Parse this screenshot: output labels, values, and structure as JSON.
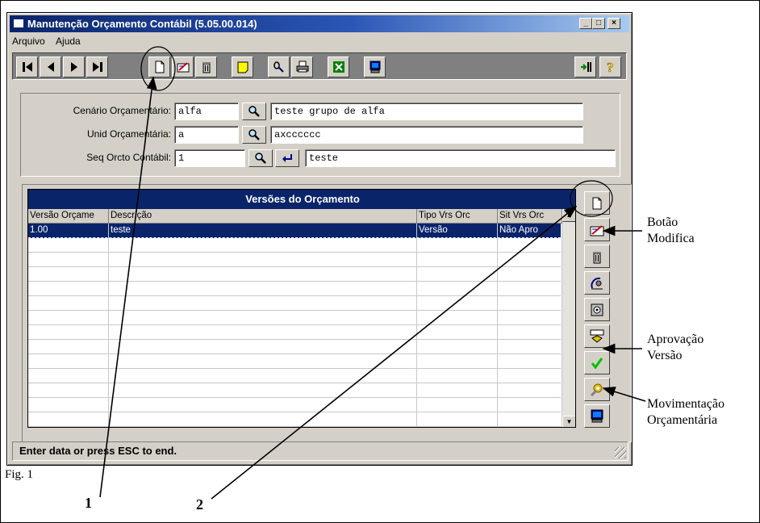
{
  "window": {
    "title": "Manutenção Orçamento Contábil (5.05.00.014)",
    "min_glyph": "_",
    "max_glyph": "□",
    "close_glyph": "×"
  },
  "menu": [
    {
      "label": "Arquivo"
    },
    {
      "label": "Ajuda"
    }
  ],
  "toolbar": {
    "buttons": [
      "first-record-icon",
      "previous-record-icon",
      "next-record-icon",
      "last-record-icon",
      "new-document-icon",
      "edit-icon",
      "delete-icon",
      "note-icon",
      "link-icon",
      "print-icon",
      "excel-icon",
      "monitor-icon",
      "goto-icon",
      "help-icon"
    ]
  },
  "form": {
    "cenario": {
      "label": "Cenário Orçamentário:",
      "code": "alfa",
      "description": "teste grupo de alfa"
    },
    "unid": {
      "label": "Unid Orçamentária:",
      "code": "a",
      "description": "axcccccc"
    },
    "seq": {
      "label": "Seq Orcto Contábil:",
      "code": "1",
      "description": "teste"
    }
  },
  "grid": {
    "title": "Versões do Orçamento",
    "columns": [
      "Versão Orçame",
      "Descrição",
      "Tipo Vrs Orc",
      "Sit Vrs Orc"
    ],
    "rows": [
      [
        "1.00",
        "teste",
        "Versão",
        "Não Apro"
      ]
    ]
  },
  "side_buttons": [
    "new-document-icon",
    "modify-icon",
    "trash-icon",
    "satellite-icon",
    "safe-icon",
    "ascii-export-icon",
    "approve-check-icon",
    "budget-movement-icon",
    "monitor-icon"
  ],
  "status": {
    "text": "Enter data or press ESC to end."
  },
  "annotations": {
    "modify": [
      "Botão",
      "Modifica"
    ],
    "approve": [
      "Aprovação",
      "Versão"
    ],
    "movement": [
      "Movimentação",
      "Orçamentária"
    ],
    "fig": "Fig. 1",
    "marker1": "1",
    "marker2": "2"
  },
  "colors": {
    "titlebar": "#0a246a",
    "face": "#d4d0c8",
    "selection": "#0a246a"
  }
}
